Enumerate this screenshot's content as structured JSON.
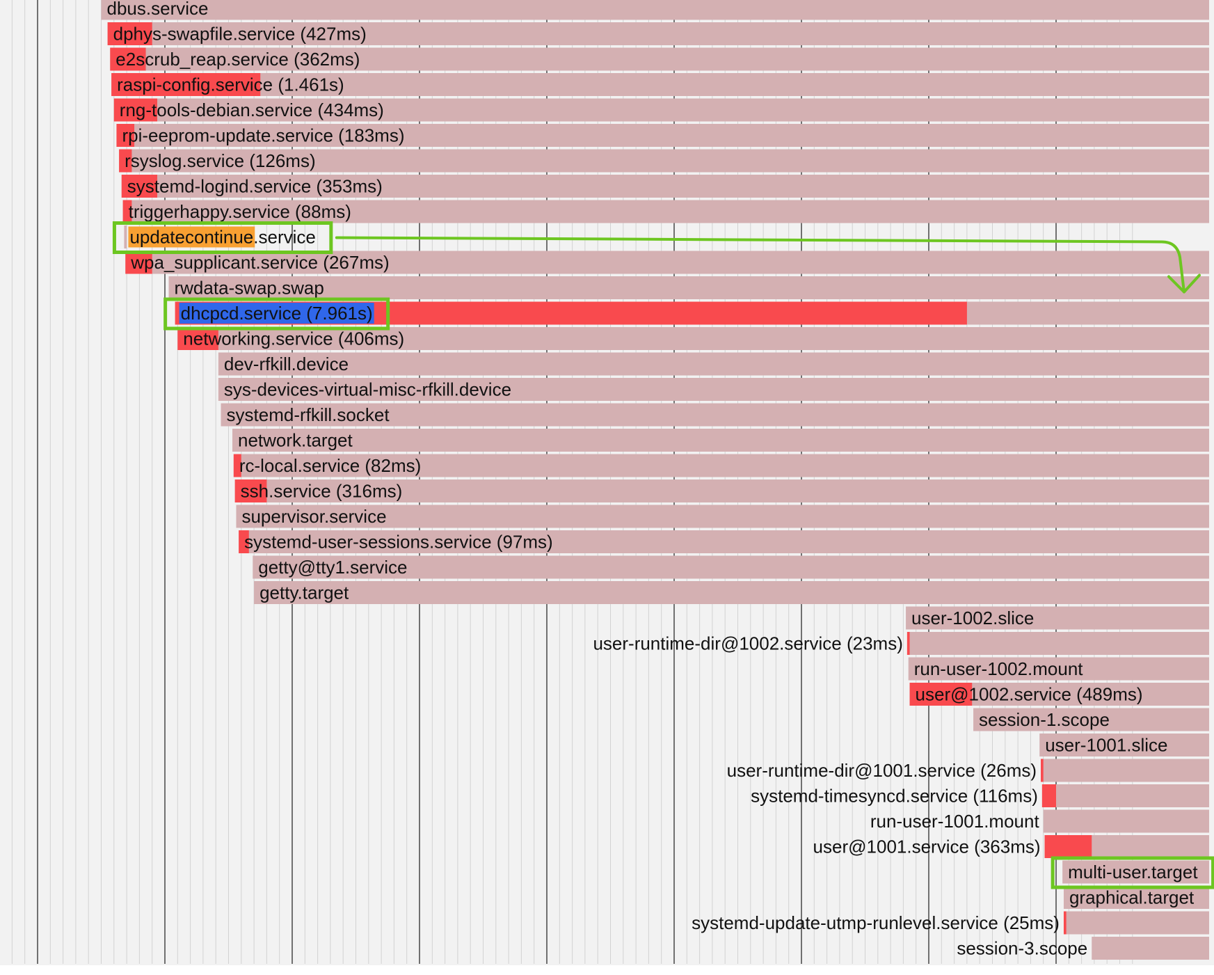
{
  "chart_data": {
    "type": "gantt",
    "title": "",
    "x_unit": "seconds",
    "x_range": [
      0,
      7.1
    ],
    "x_gridline_step": 0.1,
    "x_major_gridline_step": 1,
    "colors": {
      "background": "#f2f2f2",
      "row_bar": "#d4b0b2",
      "activating": "#f94a4e",
      "highlight_orange": "#f8a032",
      "highlight_blue": "#3067ea",
      "annotation_green": "#6dc621",
      "gridline_minor": "#d2d2d2",
      "gridline_major": "#505050"
    },
    "rows": [
      {
        "label": "dbus.service",
        "bar_start": -0.5,
        "active_start": null,
        "active_end": null
      },
      {
        "label": "dphys-swapfile.service (427ms)",
        "bar_start": -0.45,
        "active_start": -0.45,
        "active_end": -0.1
      },
      {
        "label": "e2scrub_reap.service (362ms)",
        "bar_start": -0.43,
        "active_start": -0.43,
        "active_end": -0.15
      },
      {
        "label": "raspi-config.service (1.461s)",
        "bar_start": -0.42,
        "active_start": -0.42,
        "active_end": 0.75
      },
      {
        "label": "rng-tools-debian.service (434ms)",
        "bar_start": -0.4,
        "active_start": -0.4,
        "active_end": -0.06
      },
      {
        "label": "rpi-eeprom-update.service (183ms)",
        "bar_start": -0.38,
        "active_start": -0.38,
        "active_end": -0.24
      },
      {
        "label": "rsyslog.service (126ms)",
        "bar_start": -0.36,
        "active_start": -0.36,
        "active_end": -0.26
      },
      {
        "label": "systemd-logind.service (353ms)",
        "bar_start": -0.34,
        "active_start": -0.34,
        "active_end": -0.06
      },
      {
        "label": "triggerhappy.service (88ms)",
        "bar_start": -0.33,
        "active_start": -0.33,
        "active_end": -0.26
      },
      {
        "label": "updatecontinue.service",
        "label_highlight": "updatecontinue",
        "highlight_color": "orange",
        "bar_start": -0.32,
        "active_start": null,
        "active_end": null,
        "bar_end": -0.3
      },
      {
        "label": "wpa_supplicant.service (267ms)",
        "bar_start": -0.31,
        "active_start": -0.31,
        "active_end": -0.1
      },
      {
        "label": "rwdata-swap.swap",
        "bar_start": 0.03,
        "active_start": null,
        "active_end": null
      },
      {
        "label": "dhcpcd.service (7.961s)",
        "label_highlight": "dhcpcd.service (7.961s)",
        "highlight_color": "blue",
        "bar_start": 0.08,
        "active_start": 0.08,
        "active_end": 6.3
      },
      {
        "label": "networking.service (406ms)",
        "bar_start": 0.1,
        "active_start": 0.1,
        "active_end": 0.42
      },
      {
        "label": "dev-rfkill.device",
        "bar_start": 0.42,
        "active_start": null,
        "active_end": null
      },
      {
        "label": "sys-devices-virtual-misc-rfkill.device",
        "bar_start": 0.42,
        "active_start": null,
        "active_end": null
      },
      {
        "label": "systemd-rfkill.socket",
        "bar_start": 0.44,
        "active_start": null,
        "active_end": null
      },
      {
        "label": "network.target",
        "bar_start": 0.53,
        "active_start": null,
        "active_end": null
      },
      {
        "label": "rc-local.service (82ms)",
        "bar_start": 0.54,
        "active_start": 0.54,
        "active_end": 0.6
      },
      {
        "label": "ssh.service (316ms)",
        "bar_start": 0.55,
        "active_start": 0.55,
        "active_end": 0.8
      },
      {
        "label": "supervisor.service",
        "bar_start": 0.56,
        "active_start": null,
        "active_end": null
      },
      {
        "label": "systemd-user-sessions.service (97ms)",
        "bar_start": 0.58,
        "active_start": 0.58,
        "active_end": 0.66
      },
      {
        "label": "getty@tty1.service",
        "bar_start": 0.69,
        "active_start": null,
        "active_end": null
      },
      {
        "label": "getty.target",
        "bar_start": 0.7,
        "active_start": null,
        "active_end": null
      },
      {
        "label": "user-1002.slice",
        "bar_start": 5.82,
        "active_start": null,
        "active_end": null
      },
      {
        "label": "user-runtime-dir@1002.service (23ms)",
        "bar_start": 5.83,
        "active_start": 5.83,
        "active_end": 5.85
      },
      {
        "label": "run-user-1002.mount",
        "bar_start": 5.84,
        "active_start": null,
        "active_end": null
      },
      {
        "label": "user@1002.service (489ms)",
        "bar_start": 5.85,
        "active_start": 5.85,
        "active_end": 6.34
      },
      {
        "label": "session-1.scope",
        "bar_start": 6.35,
        "active_start": null,
        "active_end": null
      },
      {
        "label": "user-1001.slice",
        "bar_start": 6.87,
        "active_start": null,
        "active_end": null
      },
      {
        "label": "user-runtime-dir@1001.service (26ms)",
        "bar_start": 6.88,
        "active_start": 6.88,
        "active_end": 6.9
      },
      {
        "label": "systemd-timesyncd.service (116ms)",
        "bar_start": 6.89,
        "active_start": 6.89,
        "active_end": 7.0
      },
      {
        "label": "run-user-1001.mount",
        "bar_start": 6.9,
        "active_start": null,
        "active_end": null
      },
      {
        "label": "user@1001.service (363ms)",
        "bar_start": 6.91,
        "active_start": 6.91,
        "active_end": 7.28
      },
      {
        "label": "multi-user.target",
        "bar_start": 7.05,
        "active_start": null,
        "active_end": null
      },
      {
        "label": "graphical.target",
        "bar_start": 7.06,
        "active_start": null,
        "active_end": null
      },
      {
        "label": "systemd-update-utmp-runlevel.service (25ms)",
        "bar_start": 7.06,
        "active_start": 7.06,
        "active_end": 7.08
      },
      {
        "label": "session-3.scope",
        "bar_start": 7.28,
        "active_start": null,
        "active_end": null
      }
    ],
    "annotations": [
      {
        "type": "box",
        "target_row": "updatecontinue.service"
      },
      {
        "type": "box",
        "target_row": "dhcpcd.service (7.961s)"
      },
      {
        "type": "box",
        "target_row": "multi-user.target"
      },
      {
        "type": "arrow",
        "from_row": "updatecontinue.service",
        "direction": "right-then-down"
      }
    ]
  }
}
